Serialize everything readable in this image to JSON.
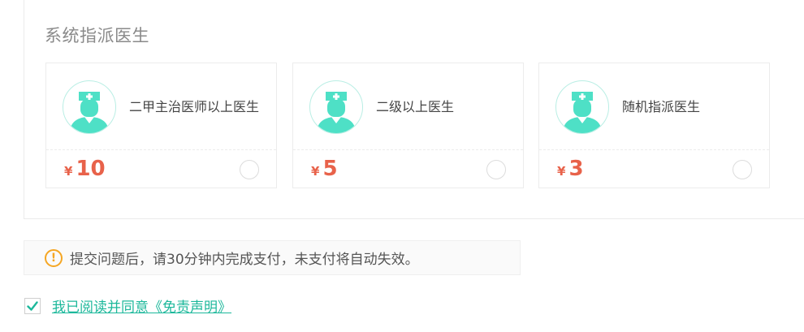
{
  "section": {
    "title": "系统指派医生"
  },
  "cards": [
    {
      "name": "二甲主治医师以上医生",
      "currency": "¥",
      "price": "10"
    },
    {
      "name": "二级以上医生",
      "currency": "¥",
      "price": "5"
    },
    {
      "name": "随机指派医生",
      "currency": "¥",
      "price": "3"
    }
  ],
  "notice": {
    "icon": "exclamation-circle-icon",
    "text": "提交问题后，请30分钟内完成支付，未支付将自动失效。"
  },
  "agreement": {
    "checked": true,
    "text": "我已阅读并同意《免责声明》"
  },
  "colors": {
    "accent": "#1db89b",
    "price": "#e8624a",
    "warning": "#f5a623",
    "avatar": "#4ee0c6"
  }
}
